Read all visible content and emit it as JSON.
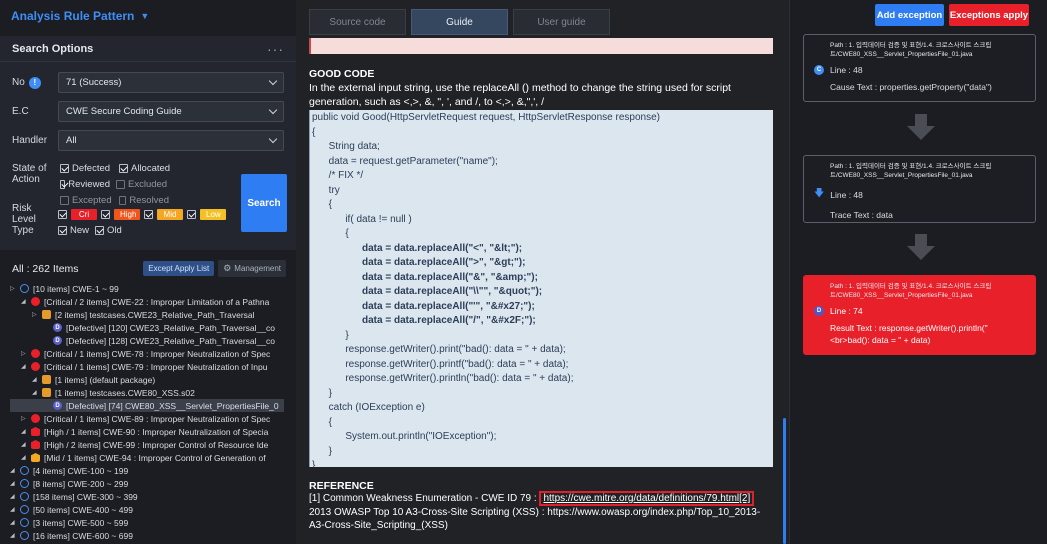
{
  "app": {
    "title": "Analysis Rule Pattern"
  },
  "search": {
    "title": "Search Options",
    "no_label": "No",
    "no_value": "71 (Success)",
    "ec_label": "E.C",
    "ec_value": "CWE Secure Coding Guide",
    "handler_label": "Handler",
    "handler_value": "All",
    "state_label": "State of Action",
    "states": [
      {
        "label": "Defected",
        "checked": true
      },
      {
        "label": "Allocated",
        "checked": true
      },
      {
        "label": "Reviewed",
        "checked": true
      },
      {
        "label": "Excluded",
        "checked": false
      },
      {
        "label": "Excepted",
        "checked": false
      },
      {
        "label": "Resolved",
        "checked": false
      }
    ],
    "risk_label": "Risk Level",
    "risks": [
      {
        "label": "Cri",
        "color": "#e8202a"
      },
      {
        "label": "High",
        "color": "#f0561c"
      },
      {
        "label": "Mid",
        "color": "#f5a623"
      },
      {
        "label": "Low",
        "color": "#f5c023"
      }
    ],
    "type_label": "Type",
    "types": [
      {
        "label": "New"
      },
      {
        "label": "Old"
      }
    ],
    "search_label": "Search"
  },
  "tree": {
    "total": "All : 262 Items",
    "except_label": "Except Apply List",
    "mgmt_label": "Management",
    "nodes": [
      {
        "text": "[10 items] CWE-1 ~ 99",
        "icon": "cwe",
        "indent": 0,
        "arrow": "▷"
      },
      {
        "text": "[Critical / 2 items] CWE-22 : Improper Limitation of a Pathna",
        "icon": "crit",
        "indent": 1,
        "arrow": "◢"
      },
      {
        "text": "[2 items] testcases.CWE23_Relative_Path_Traversal",
        "icon": "pkg",
        "indent": 2,
        "arrow": "▷"
      },
      {
        "text": "[Defective] [120] CWE23_Relative_Path_Traversal__co",
        "icon": "def",
        "indent": 3,
        "arrow": ""
      },
      {
        "text": "[Defective] [128] CWE23_Relative_Path_Traversal__co",
        "icon": "def",
        "indent": 3,
        "arrow": ""
      },
      {
        "text": "[Critical / 1 items] CWE-78 : Improper Neutralization of Spec",
        "icon": "crit",
        "indent": 1,
        "arrow": "▷"
      },
      {
        "text": "[Critical / 1 items] CWE-79 : Improper Neutralization of Inpu",
        "icon": "crit",
        "indent": 1,
        "arrow": "◢"
      },
      {
        "text": "[1 items] (default package)",
        "icon": "pkg",
        "indent": 2,
        "arrow": "◢"
      },
      {
        "text": "[1 items] testcases.CWE80_XSS.s02",
        "icon": "pkg",
        "indent": 2,
        "arrow": "◢"
      },
      {
        "text": "[Defective] [74] CWE80_XSS__Servlet_PropertiesFile_0",
        "icon": "def",
        "indent": 3,
        "arrow": "",
        "selected": true
      },
      {
        "text": "[Critical / 1 items] CWE-89 : Improper Neutralization of Spec",
        "icon": "crit",
        "indent": 1,
        "arrow": "▷"
      },
      {
        "text": "[High / 1 items] CWE-90 : Improper Neutralization of Specia",
        "icon": "high",
        "indent": 1,
        "arrow": "◢"
      },
      {
        "text": "[High / 2 items] CWE-99 : Improper Control of Resource Ide",
        "icon": "high",
        "indent": 1,
        "arrow": "◢"
      },
      {
        "text": "[Mid / 1 items] CWE-94 : Improper Control of Generation of",
        "icon": "mid",
        "indent": 1,
        "arrow": "◢"
      },
      {
        "text": "[4 items] CWE-100 ~ 199",
        "icon": "cwe",
        "indent": 0,
        "arrow": "◢"
      },
      {
        "text": "[8 items] CWE-200 ~ 299",
        "icon": "cwe",
        "indent": 0,
        "arrow": "◢"
      },
      {
        "text": "[158 items] CWE-300 ~ 399",
        "icon": "cwe",
        "indent": 0,
        "arrow": "◢"
      },
      {
        "text": "[50 items] CWE-400 ~ 499",
        "icon": "cwe",
        "indent": 0,
        "arrow": "◢"
      },
      {
        "text": "[3 items] CWE-500 ~ 599",
        "icon": "cwe",
        "indent": 0,
        "arrow": "◢"
      },
      {
        "text": "[16 items] CWE-600 ~ 699",
        "icon": "cwe",
        "indent": 0,
        "arrow": "◢"
      }
    ]
  },
  "tabs": [
    {
      "label": "Source code",
      "active": false
    },
    {
      "label": "Guide",
      "active": true
    },
    {
      "label": "User guide",
      "active": false
    }
  ],
  "guide": {
    "good_code_title": "GOOD CODE",
    "good_code_desc": "In the external input string, use the replaceAll () method to change the string used for script generation, such as <,>, &, \", ', and /, to <,>, &,\",', /",
    "code_lines": [
      {
        "text": "public void Good(HttpServletRequest request, HttpServletResponse response)",
        "bold": false
      },
      {
        "text": "{",
        "bold": false
      },
      {
        "text": "      String data;",
        "bold": false
      },
      {
        "text": "      data = request.getParameter(\"name\");",
        "bold": false
      },
      {
        "text": "      /* FIX */",
        "bold": false
      },
      {
        "text": "      try",
        "bold": false
      },
      {
        "text": "      {",
        "bold": false
      },
      {
        "text": "            if( data != null )",
        "bold": false
      },
      {
        "text": "            {",
        "bold": false
      },
      {
        "text": "                  data = data.replaceAll(\"<\", \"&lt;\");",
        "bold": true
      },
      {
        "text": "                  data = data.replaceAll(\">\", \"&gt;\");",
        "bold": true
      },
      {
        "text": "                  data = data.replaceAll(\"&\", \"&amp;\");",
        "bold": true
      },
      {
        "text": "                  data = data.replaceAll(\"\\\\\"\", \"&quot;\");",
        "bold": true
      },
      {
        "text": "                  data = data.replaceAll(\"'\", \"&#x27;\");",
        "bold": true
      },
      {
        "text": "                  data = data.replaceAll(\"/\", \"&#x2F;\");",
        "bold": true
      },
      {
        "text": "            }",
        "bold": false
      },
      {
        "text": "            response.getWriter().print(\"bad(): data = \" + data);",
        "bold": false
      },
      {
        "text": "            response.getWriter().printf(\"bad(): data = \" + data);",
        "bold": false
      },
      {
        "text": "            response.getWriter().println(\"bad(): data = \" + data);",
        "bold": false
      },
      {
        "text": "      }",
        "bold": false
      },
      {
        "text": "      catch (IOException e)",
        "bold": false
      },
      {
        "text": "      {",
        "bold": false
      },
      {
        "text": "            System.out.println(\"IOException\");",
        "bold": false
      },
      {
        "text": "      }",
        "bold": false
      },
      {
        "text": "}",
        "bold": false
      }
    ],
    "reference_title": "REFERENCE",
    "ref1_prefix": "[1] Common Weakness Enumeration - CWE ID 79 :",
    "ref1_link": "https://cwe.mitre.org/data/definitions/79.html[2]",
    "ref2": "2013 OWASP Top 10 A3-Cross-Site Scripting (XSS) : https://www.owasp.org/index.php/Top_10_2013-",
    "ref3": "A3-Cross-Site_Scripting_(XSS)"
  },
  "trace": {
    "add_label": "Add exception",
    "exceptions_label": "Exceptions apply",
    "cards": [
      {
        "path1": "Path : 1. 입력데이터 검증 및 표현/1.4. 크로스사이트 스크립",
        "path2": "트/CWE80_XSS__Servlet_PropertiesFile_01.java",
        "line": "Line : 48",
        "text": "Cause Text : properties.getProperty(\"data\")",
        "badge": "C",
        "kind": "cause"
      },
      {
        "path1": "Path : 1. 입력데이터 검증 및 표현/1.4. 크로스사이트 스크립",
        "path2": "트/CWE80_XSS__Servlet_PropertiesFile_01.java",
        "line": "Line : 48",
        "text": "Trace Text : data",
        "badge": "↓",
        "kind": "trace"
      },
      {
        "path1": "Path : 1. 입력데이터 검증 및 표현/1.4. 크로스사이트 스크립",
        "path2": "트/CWE80_XSS__Servlet_PropertiesFile_01.java",
        "line": "Line : 74",
        "text": "Result Text : response.getWriter().println(\"<br>bad(): data = \" + data)",
        "badge": "D",
        "kind": "result"
      }
    ]
  }
}
